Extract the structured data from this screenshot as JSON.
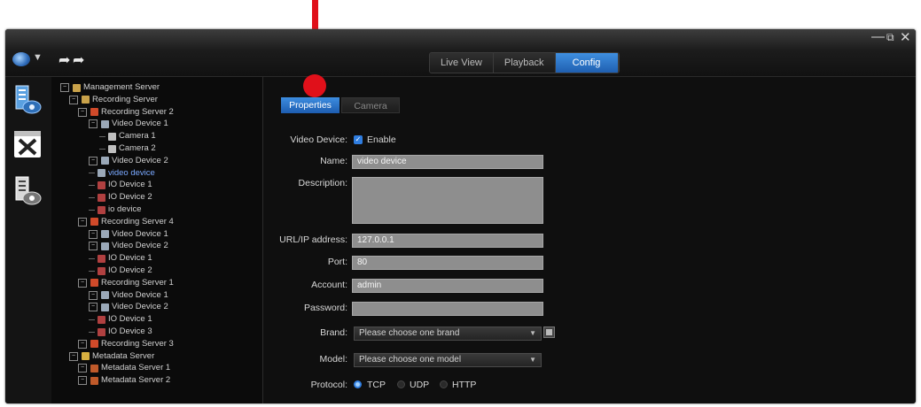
{
  "nav": {
    "tabs": [
      {
        "label": "Live View",
        "active": false
      },
      {
        "label": "Playback",
        "active": false
      },
      {
        "label": "Config",
        "active": true
      }
    ]
  },
  "window_controls": [
    "minimize-icon",
    "restore-icon",
    "close-icon"
  ],
  "sidebar_icons": [
    "device-monitor-icon",
    "tools-icon",
    "server-monitor-icon"
  ],
  "tree": [
    {
      "label": "Management Server",
      "icon": "server-icon"
    },
    {
      "label": "Recording Server",
      "icon": "server-icon"
    },
    {
      "label": "Recording Server 2",
      "icon": "recording-server-icon"
    },
    {
      "label": "Video Device 1",
      "icon": "video-device-icon"
    },
    {
      "label": "Camera 1",
      "icon": "camera-icon"
    },
    {
      "label": "Camera 2",
      "icon": "camera-icon"
    },
    {
      "label": "Video Device 2",
      "icon": "video-device-icon"
    },
    {
      "label": "video device",
      "icon": "video-device-icon",
      "selected": true
    },
    {
      "label": "IO Device 1",
      "icon": "io-device-icon"
    },
    {
      "label": "IO Device 2",
      "icon": "io-device-icon"
    },
    {
      "label": "io device",
      "icon": "io-device-icon"
    },
    {
      "label": "Recording Server 4",
      "icon": "recording-server-icon"
    },
    {
      "label": "Video Device 1",
      "icon": "video-device-icon"
    },
    {
      "label": "Video Device 2",
      "icon": "video-device-icon"
    },
    {
      "label": "IO Device 1",
      "icon": "io-device-icon"
    },
    {
      "label": "IO Device 2",
      "icon": "io-device-icon"
    },
    {
      "label": "Recording Server 1",
      "icon": "recording-server-icon"
    },
    {
      "label": "Video Device 1",
      "icon": "video-device-icon"
    },
    {
      "label": "Video Device 2",
      "icon": "video-device-icon"
    },
    {
      "label": "IO Device 1",
      "icon": "io-device-icon"
    },
    {
      "label": "IO Device 3",
      "icon": "io-device-icon"
    },
    {
      "label": "Recording Server 3",
      "icon": "recording-server-icon"
    },
    {
      "label": "Metadata Server",
      "icon": "metadata-server-icon"
    },
    {
      "label": "Metadata Server 1",
      "icon": "metadata-icon"
    },
    {
      "label": "Metadata Server 2",
      "icon": "metadata-icon"
    }
  ],
  "tabs": {
    "properties": "Properties",
    "camera": "Camera"
  },
  "form": {
    "video_device_label": "Video Device:",
    "enable_label": "Enable",
    "enable_checked": true,
    "name_label": "Name:",
    "name_value": "video device",
    "description_label": "Description:",
    "description_value": "",
    "url_label": "URL/IP address:",
    "url_value": "127.0.0.1",
    "port_label": "Port:",
    "port_value": "80",
    "account_label": "Account:",
    "account_value": "admin",
    "password_label": "Password:",
    "password_value": "",
    "brand_label": "Brand:",
    "brand_value": "Please choose one brand",
    "model_label": "Model:",
    "model_value": "Please choose one model",
    "protocol_label": "Protocol:",
    "protocol_options": [
      "TCP",
      "UDP",
      "HTTP"
    ],
    "protocol_selected": "TCP"
  },
  "colors": {
    "accent": "#2f7de0",
    "annotation": "#e0101a"
  }
}
